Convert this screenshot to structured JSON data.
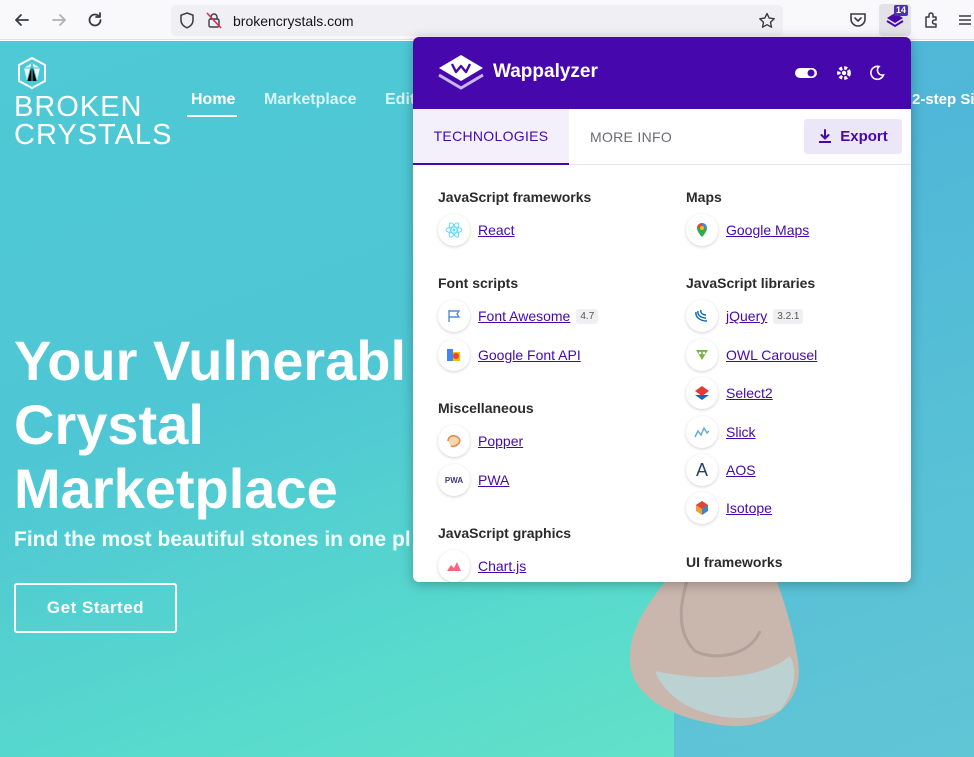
{
  "browser": {
    "url": "brokencrystals.com",
    "extension_badge": "14"
  },
  "site": {
    "logo": "BROKEN CRYSTALS",
    "logo_line1": "BROKEN",
    "logo_line2": "CRYSTALS",
    "nav": [
      "Home",
      "Marketplace",
      "Edit"
    ],
    "nav_right": "2-step Si",
    "hero_lines": [
      "Your Vulnerabl",
      "Crystal",
      "Marketplace"
    ],
    "subtitle": "Find the most beautiful stones in one pl",
    "cta": "Get Started"
  },
  "popup": {
    "title": "Wappalyzer",
    "tabs": [
      "TECHNOLOGIES",
      "MORE INFO"
    ],
    "export": "Export",
    "left_column": [
      {
        "category": "JavaScript frameworks",
        "items": [
          {
            "name": "React",
            "version": ""
          }
        ]
      },
      {
        "category": "Font scripts",
        "items": [
          {
            "name": "Font Awesome",
            "version": "4.7"
          },
          {
            "name": "Google Font API",
            "version": ""
          }
        ]
      },
      {
        "category": "Miscellaneous",
        "items": [
          {
            "name": "Popper",
            "version": ""
          },
          {
            "name": "PWA",
            "version": ""
          }
        ]
      },
      {
        "category": "JavaScript graphics",
        "items": [
          {
            "name": "Chart.js",
            "version": ""
          }
        ]
      }
    ],
    "right_column": [
      {
        "category": "Maps",
        "items": [
          {
            "name": "Google Maps",
            "version": ""
          }
        ]
      },
      {
        "category": "JavaScript libraries",
        "items": [
          {
            "name": "jQuery",
            "version": "3.2.1"
          },
          {
            "name": "OWL Carousel",
            "version": ""
          },
          {
            "name": "Select2",
            "version": ""
          },
          {
            "name": "Slick",
            "version": ""
          },
          {
            "name": "AOS",
            "version": ""
          },
          {
            "name": "Isotope",
            "version": ""
          }
        ]
      },
      {
        "category": "UI frameworks",
        "items": []
      }
    ]
  },
  "colors": {
    "wappalyzer_purple": "#4608ad",
    "site_teal": "#4fc9d6"
  }
}
